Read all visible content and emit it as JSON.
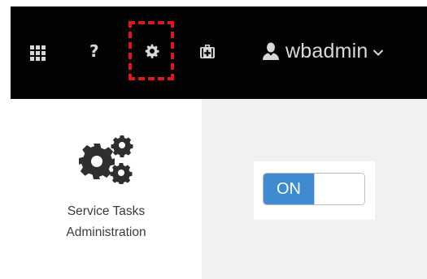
{
  "header": {
    "user": {
      "name": "wbadmin"
    },
    "icons": {
      "apps": "apps-grid-icon",
      "help": "?",
      "settings": "gear-icon",
      "kit": "medical-kit-icon",
      "user": "user-icon",
      "caret": "chevron-down-icon"
    }
  },
  "card": {
    "title_line1": "Service Tasks",
    "title_line2": "Administration",
    "icon": "cogs-icon"
  },
  "toggle": {
    "state_label": "ON"
  },
  "colors": {
    "header_bg": "#030303",
    "highlight_border": "#e0161c",
    "toggle_on": "#3f8bd0",
    "page_bg": "#f1f1f1"
  }
}
